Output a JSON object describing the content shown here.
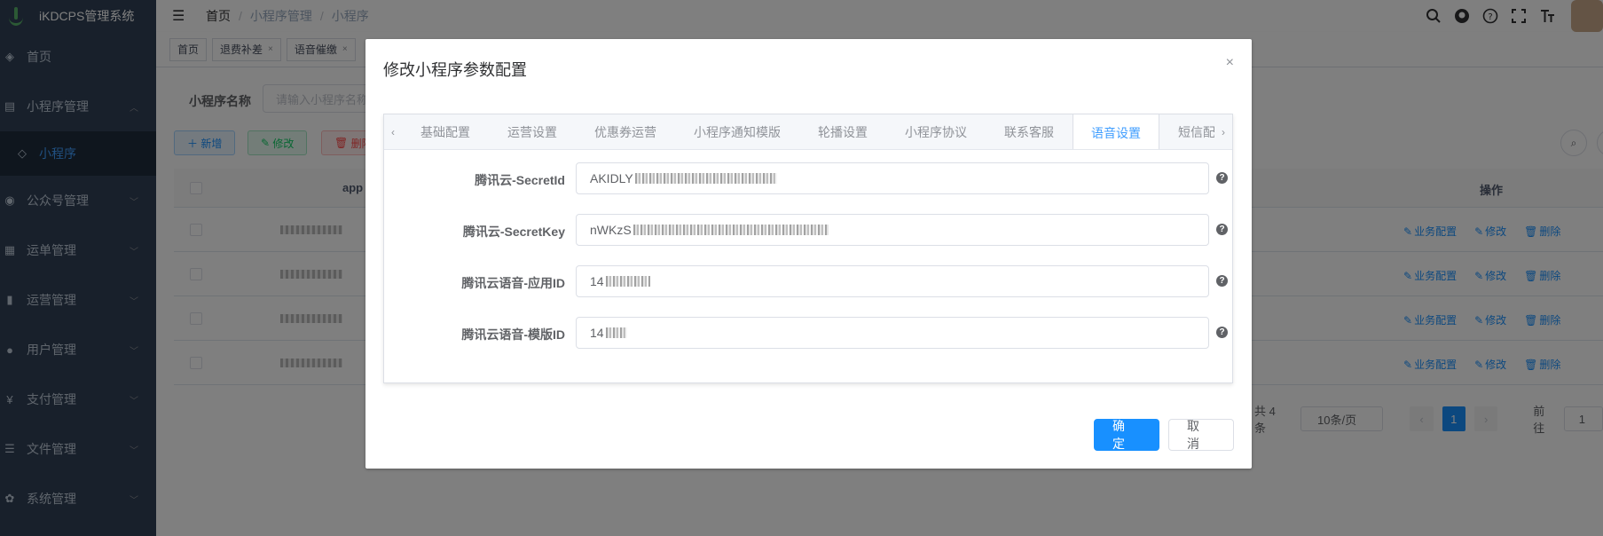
{
  "app": {
    "title": "iKDCPS管理系统"
  },
  "sidebar": {
    "items": [
      {
        "label": "首页",
        "icon": "dashboard-icon",
        "glyph": "◈",
        "chevron": false
      },
      {
        "label": "小程序管理",
        "icon": "miniapp-icon",
        "glyph": "▤",
        "chevron": true,
        "expanded": true
      },
      {
        "label": "小程序",
        "icon": "shield-icon",
        "glyph": "◇",
        "sub": true
      },
      {
        "label": "公众号管理",
        "icon": "wechat-icon",
        "glyph": "◉",
        "chevron": true
      },
      {
        "label": "运单管理",
        "icon": "waybill-icon",
        "glyph": "▦",
        "chevron": true
      },
      {
        "label": "运营管理",
        "icon": "chart-icon",
        "glyph": "▮",
        "chevron": true
      },
      {
        "label": "用户管理",
        "icon": "user-icon",
        "glyph": "●",
        "chevron": true
      },
      {
        "label": "支付管理",
        "icon": "yen-icon",
        "glyph": "¥",
        "chevron": true
      },
      {
        "label": "文件管理",
        "icon": "file-icon",
        "glyph": "☰",
        "chevron": true
      },
      {
        "label": "系统管理",
        "icon": "gear-icon",
        "glyph": "✿",
        "chevron": true
      }
    ]
  },
  "navbar": {
    "breadcrumb": [
      "首页",
      "小程序管理",
      "小程序"
    ]
  },
  "tags_view": {
    "tags": [
      {
        "label": "首页",
        "closable": false
      },
      {
        "label": "退费补差",
        "closable": true
      },
      {
        "label": "语音催缴",
        "closable": true
      }
    ]
  },
  "page": {
    "search_label": "小程序名称",
    "search_placeholder": "请输入小程序名称",
    "buttons": {
      "add": "新增",
      "edit": "修改",
      "delete": "删除"
    },
    "table": {
      "col_app": "app",
      "col_ops": "操作",
      "row_ops": [
        "业务配置",
        "修改",
        "删除"
      ],
      "row_count": 4
    },
    "pagination": {
      "total": "共 4 条",
      "page_size": "10条/页",
      "current": "1",
      "goto_label": "前往",
      "goto_value": "1"
    }
  },
  "dialog": {
    "title": "修改小程序参数配置",
    "close_glyph": "×",
    "tabs": [
      "基础配置",
      "运营设置",
      "优惠券运营",
      "小程序通知模版",
      "轮播设置",
      "小程序协议",
      "联系客服",
      "语音设置",
      "短信配置"
    ],
    "active_tab": "语音设置",
    "fields": [
      {
        "label": "腾讯云-SecretId",
        "value": "AKIDLY"
      },
      {
        "label": "腾讯云-SecretKey",
        "value": "nWKzS"
      },
      {
        "label": "腾讯云语音-应用ID",
        "value": "14"
      },
      {
        "label": "腾讯云语音-模版ID",
        "value": "14"
      }
    ],
    "confirm": "确 定",
    "cancel": "取 消"
  },
  "colors": {
    "primary": "#1890ff",
    "sidebar_bg": "#304156",
    "active_tab": "#409eff"
  }
}
